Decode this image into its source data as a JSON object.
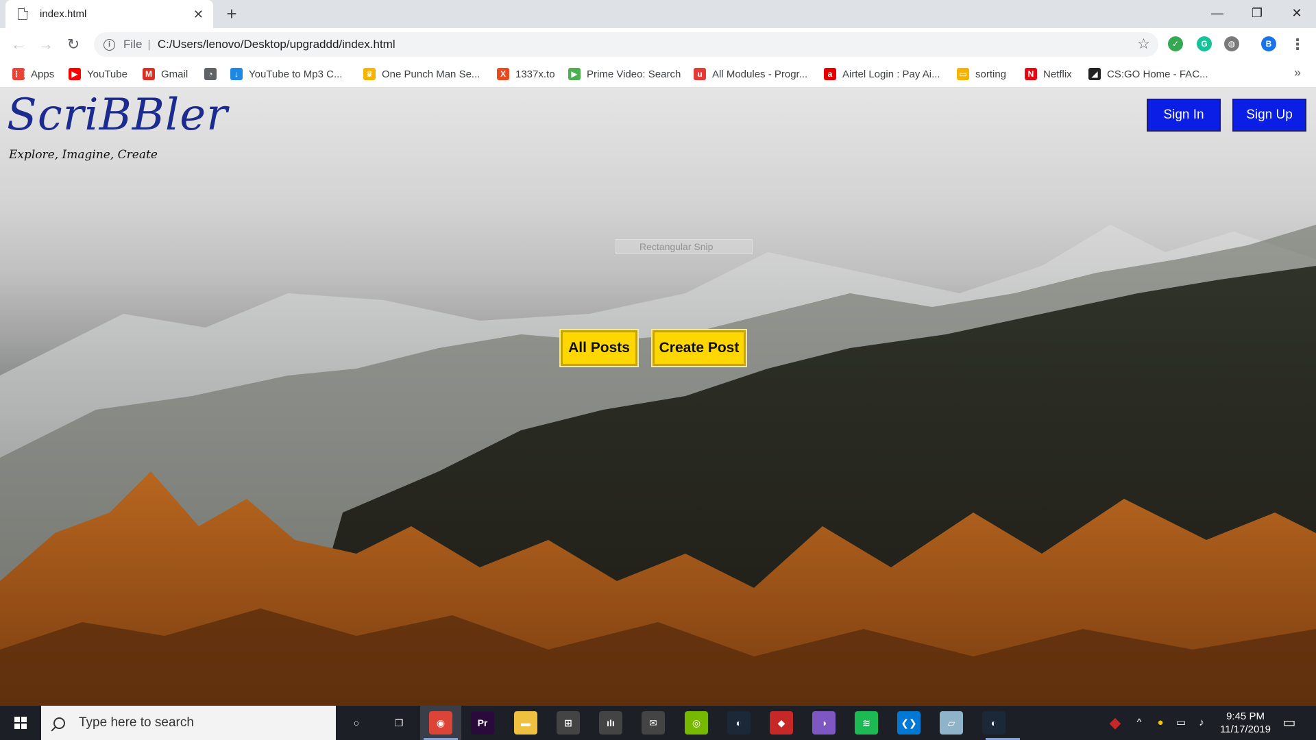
{
  "browser": {
    "tab_title": "index.html",
    "tab_close": "✕",
    "new_tab": "+",
    "window_controls": {
      "minimize": "—",
      "maximize": "❐",
      "close": "✕"
    },
    "nav": {
      "back": "←",
      "forward": "→",
      "reload": "↻"
    },
    "address": {
      "scheme": "File",
      "separator": "|",
      "url": "C:/Users/lenovo/Desktop/upgraddd/index.html"
    },
    "extensions": [
      {
        "name": "shield-extension-icon",
        "color": "#34a853",
        "glyph": "✓"
      },
      {
        "name": "grammarly-extension-icon",
        "color": "#15c39a",
        "glyph": "G"
      },
      {
        "name": "globe-extension-icon",
        "color": "#7a7a7a",
        "glyph": "◍"
      },
      {
        "name": "profile-avatar",
        "color": "#1a73e8",
        "glyph": "B"
      }
    ],
    "menu": "⋮",
    "bookmarks": [
      {
        "label": "Apps",
        "icon": "apps-grid-icon",
        "color": "#ea4335",
        "glyph": "⋮⋮"
      },
      {
        "label": "YouTube",
        "icon": "youtube-icon",
        "color": "#ff0000",
        "glyph": "▶"
      },
      {
        "label": "Gmail",
        "icon": "gmail-icon",
        "color": "#d93025",
        "glyph": "M"
      },
      {
        "label": "",
        "icon": "speedometer-icon",
        "color": "#5f6368",
        "glyph": "◔"
      },
      {
        "label": "YouTube to Mp3 C...",
        "icon": "download-cloud-icon",
        "color": "#1e88e5",
        "glyph": "↓"
      },
      {
        "label": "One Punch Man Se...",
        "icon": "crown-icon",
        "color": "#f5b400",
        "glyph": "♛"
      },
      {
        "label": "1337x.to",
        "icon": "x-logo-icon",
        "color": "#e8491d",
        "glyph": "X"
      },
      {
        "label": "Prime Video: Search",
        "icon": "play-circle-icon",
        "color": "#4caf50",
        "glyph": "▶"
      },
      {
        "label": "All Modules - Progr...",
        "icon": "upgrad-icon",
        "color": "#e53935",
        "glyph": "u"
      },
      {
        "label": "Airtel Login : Pay Ai...",
        "icon": "airtel-icon",
        "color": "#e40000",
        "glyph": "a"
      },
      {
        "label": "sorting",
        "icon": "slides-icon",
        "color": "#f4b400",
        "glyph": "▭"
      },
      {
        "label": "Netflix",
        "icon": "netflix-icon",
        "color": "#e50914",
        "glyph": "N"
      },
      {
        "label": "CS:GO Home - FAC...",
        "icon": "faceit-icon",
        "color": "#222222",
        "glyph": "◢"
      }
    ],
    "bookmarks_more": "»"
  },
  "page": {
    "logo": "ScriBBler",
    "tagline": "Explore, Imagine, Create",
    "sign_in": "Sign In",
    "sign_up": "Sign Up",
    "all_posts": "All Posts",
    "create_post": "Create Post",
    "snip_overlay": "Rectangular Snip"
  },
  "taskbar": {
    "search_placeholder": "Type here to search",
    "apps": [
      {
        "name": "cortana-icon",
        "color": "transparent",
        "glyph": "○"
      },
      {
        "name": "task-view-icon",
        "color": "transparent",
        "glyph": "❐"
      },
      {
        "name": "chrome-icon",
        "color": "#db4437",
        "glyph": "◉"
      },
      {
        "name": "premiere-pro-icon",
        "color": "#2a0a3a",
        "glyph": "Pr"
      },
      {
        "name": "file-explorer-icon",
        "color": "#f0c040",
        "glyph": "▬"
      },
      {
        "name": "microsoft-store-icon",
        "color": "#444",
        "glyph": "⊞"
      },
      {
        "name": "equalizer-app-icon",
        "color": "#444",
        "glyph": "ıIı"
      },
      {
        "name": "mail-icon",
        "color": "#444",
        "glyph": "✉"
      },
      {
        "name": "nvidia-icon",
        "color": "#76b900",
        "glyph": "◎"
      },
      {
        "name": "steam-icon",
        "color": "#1b2838",
        "glyph": "◐"
      },
      {
        "name": "vpn-shield-icon",
        "color": "#c62828",
        "glyph": "◆"
      },
      {
        "name": "tor-browser-icon",
        "color": "#7e57c2",
        "glyph": "◑"
      },
      {
        "name": "spotify-icon",
        "color": "#1db954",
        "glyph": "≋"
      },
      {
        "name": "vscode-icon",
        "color": "#0078d4",
        "glyph": "❮❯"
      },
      {
        "name": "notes-app-icon",
        "color": "#8fb3c8",
        "glyph": "▱"
      },
      {
        "name": "steam-running-icon",
        "color": "#1b2838",
        "glyph": "◐"
      }
    ],
    "tray": {
      "time": "9:45 PM",
      "date": "11/17/2019",
      "chevron": "^",
      "notification": "▭"
    }
  },
  "colors": {
    "brand_blue": "#1b2b8f",
    "auth_button": "#0a1ee6",
    "cta_button": "#ffd700"
  }
}
